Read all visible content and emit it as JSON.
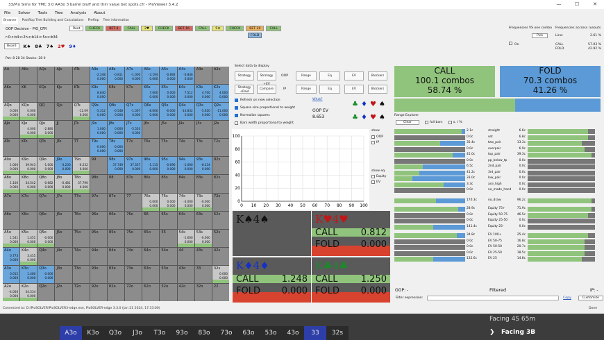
{
  "window": {
    "title": "33/Pio Sims for TMC 3:0 AA3o 3 barrel bluff and thin value bet spots.cfr - PioViewer 3.4.2",
    "min": "—",
    "max": "☐",
    "close": "✕"
  },
  "menu": [
    "File",
    "Solver",
    "Tools",
    "Tree",
    "Analysis",
    "About"
  ],
  "tabs": [
    "Browser",
    "Postflop Tree Building and Calculations",
    "Preflop",
    "Tree information"
  ],
  "decision": "OOP Decision - PIO_CFR",
  "board_line": "r:0:c:b4:c:2h:c:b14:c:5s:c:b34",
  "start_label": "Board",
  "board_cards": [
    {
      "t": "K♠",
      "c": "#111"
    },
    {
      "t": "8♣",
      "c": "#111"
    },
    {
      "t": "7♠",
      "c": "#111"
    },
    {
      "t": "2♥",
      "c": "#c01818"
    },
    {
      "t": "9♦",
      "c": "#1530c8"
    }
  ],
  "pot": "Pot: 8  28 34  Stacks: 28 0",
  "nav": [
    {
      "t": "Root",
      "bg": "#ffffff"
    },
    {
      "t": "CHECK",
      "bg": "#90c47c"
    },
    {
      "t": "BET 4",
      "bg": "#d36b62"
    },
    {
      "t": "CALL",
      "bg": "#90c47c"
    },
    {
      "t": "2♥",
      "bg": "#e6e37a"
    },
    {
      "t": "CHECK",
      "bg": "#90c47c"
    },
    {
      "t": "BET 16",
      "bg": "#d36b62"
    },
    {
      "t": "CALL",
      "bg": "#90c47c"
    },
    {
      "t": "9♦",
      "bg": "#e6e37a"
    },
    {
      "t": "CHECK",
      "bg": "#90c47c"
    },
    {
      "t": "BET 20",
      "bg": "#e8b060"
    },
    {
      "t": "CALL",
      "bg": "#90c47c"
    }
  ],
  "fold_tag": "FOLD",
  "grid": [
    [
      "AA",
      "AKs",
      "AQs",
      "AJs",
      "ATs",
      "A9s",
      "A8s",
      "A7s",
      "A6s",
      "A5s",
      "A4s",
      "A3s",
      "A2s"
    ],
    [
      "AKo",
      "KK",
      "KQs",
      "KJs",
      "KTs",
      "K9s",
      "K8s",
      "K7s",
      "K6s",
      "K5s",
      "K4s",
      "K3s",
      "K2s"
    ],
    [
      "AQo",
      "KQo",
      "QQ",
      "QJs",
      "QTs",
      "Q9s",
      "Q8s",
      "Q7s",
      "Q6s",
      "Q5s",
      "Q4s",
      "Q3s",
      "Q2s"
    ],
    [
      "AJo",
      "KJo",
      "QJo",
      "JJ",
      "JTs",
      "J9s",
      "J8s",
      "J7s",
      "J6s",
      "J5s",
      "J4s",
      "J3s",
      "J2s"
    ],
    [
      "ATo",
      "KTo",
      "QTo",
      "JTo",
      "TT",
      "T9s",
      "T8s",
      "T7s",
      "T6s",
      "T5s",
      "T4s",
      "T3s",
      "T2s"
    ],
    [
      "A9o",
      "K9o",
      "Q9o",
      "J9o",
      "T9o",
      "99",
      "98s",
      "97s",
      "96s",
      "95s",
      "94s",
      "93s",
      "92s"
    ],
    [
      "A8o",
      "K8o",
      "Q8o",
      "J8o",
      "T8o",
      "98o",
      "88",
      "87s",
      "86s",
      "85s",
      "84s",
      "83s",
      "82s"
    ],
    [
      "A7o",
      "K7o",
      "Q7o",
      "J7o",
      "T7o",
      "97o",
      "87o",
      "77",
      "76s",
      "75s",
      "74s",
      "73s",
      "72s"
    ],
    [
      "A6o",
      "K6o",
      "Q6o",
      "J6o",
      "T6o",
      "96o",
      "86o",
      "76o",
      "66",
      "65s",
      "64s",
      "63s",
      "62s"
    ],
    [
      "A5o",
      "K5o",
      "Q5o",
      "J5o",
      "T5o",
      "95o",
      "85o",
      "75o",
      "65o",
      "55",
      "54s",
      "53s",
      "52s"
    ],
    [
      "A4o",
      "K4o",
      "Q4o",
      "J4o",
      "T4o",
      "94o",
      "84o",
      "74o",
      "64o",
      "54o",
      "44",
      "43s",
      "42s"
    ],
    [
      "A3o",
      "K3o",
      "Q3o",
      "J3o",
      "T3o",
      "93o",
      "83o",
      "73o",
      "63o",
      "53o",
      "43o",
      "33",
      "32s"
    ],
    [
      "A2o",
      "K2o",
      "Q2o",
      "J2o",
      "T2o",
      "92o",
      "82o",
      "72o",
      "62o",
      "52o",
      "42o",
      "32o",
      "22"
    ]
  ],
  "cell_values": {
    "A9s": [
      "-2.348",
      "0.000"
    ],
    "A8s": [
      "-0.811",
      "0.000"
    ],
    "A7s": [
      "-1.000",
      "0.000"
    ],
    "A6s": [
      "-3.194",
      "0.000"
    ],
    "A5s": [
      "-0.892",
      "0.000"
    ],
    "A4s": [
      "-0.846",
      "0.000"
    ],
    "K9s": [
      "8.840",
      "0.000"
    ],
    "K6s": [
      "7.600",
      "0.000"
    ],
    "K5s": [
      "0.000",
      "0.000"
    ],
    "K4s": [
      "7.512",
      "0.000"
    ],
    "K3s": [
      "4.700",
      "0.000"
    ],
    "K2s": [
      "4.000",
      "0.000"
    ],
    "Q9s": [
      "-5.312",
      "0.000"
    ],
    "Q8s": [
      "-0.548",
      "0.000"
    ],
    "Q7s": [
      "-1.007",
      "0.000"
    ],
    "Q6s": [
      "-8.000",
      "0.000"
    ],
    "Q5s": [
      "-6.000",
      "0.000"
    ],
    "Q4s": [
      "-14.832",
      "0.000"
    ],
    "Q3s": [
      "-5.620",
      "0.000"
    ],
    "Q2s": [
      "-11.000",
      "0.000"
    ],
    "QTs": [
      "-12.09",
      "0.000"
    ],
    "KQo": [
      "0.000",
      "0.000"
    ],
    "AQo": [
      "0.000",
      "0.000"
    ],
    "KJo": [
      "4.000",
      "0.000"
    ],
    "QJo": [
      "-2.880",
      "0.000"
    ],
    "J9s": [
      "1.000",
      "0.000"
    ],
    "J8s": [
      "0.000",
      "0.000"
    ],
    "J7s": [
      "-5.520",
      "0.000"
    ],
    "T9s": [
      "-0.000",
      "0.000"
    ],
    "T8s": [
      "-0.000",
      "0.000"
    ],
    "A9o": [
      "1.000",
      "0.000"
    ],
    "K9o": [
      "39.943",
      "0.000"
    ],
    "Q9o": [
      "-1.000",
      "0.000"
    ],
    "J9o": [
      "-3.230",
      "0.000"
    ],
    "T9o": [
      "-6.232",
      "0.000"
    ],
    "98s": [
      "37.749",
      "0.000"
    ],
    "97s": [
      "37.537",
      "0.000"
    ],
    "96s": [
      "-1.115",
      "0.000"
    ],
    "95s": [
      "-0.690",
      "0.000"
    ],
    "94s": [
      "-1.000",
      "0.000"
    ],
    "93s": [
      "-8.234",
      "0.000"
    ],
    "A8o": [
      "1.100",
      "0.000"
    ],
    "K8o": [
      "34.542",
      "0.000"
    ],
    "Q8o": [
      "-0.682",
      "0.000"
    ],
    "J8o": [
      "-0.481",
      "0.000"
    ],
    "T8o": [
      "37.790",
      "0.000"
    ],
    "76s": [
      "0.000",
      "0.000"
    ],
    "75s": [
      "0.000",
      "0.000"
    ],
    "74s": [
      "-3.000",
      "0.000"
    ],
    "73s": [
      "-0.000",
      "0.000"
    ],
    "A5o": [
      "1.541",
      "0.000"
    ],
    "K5o": [
      "1.451",
      "0.000"
    ],
    "Q5o": [
      "-0.000",
      "0.000"
    ],
    "54s": [
      "-1.600",
      "0.000"
    ],
    "53s": [
      "-0.000",
      "0.000"
    ],
    "A4o": [
      "0.773",
      "0.000"
    ],
    "K4o": [
      "3.455",
      "0.000"
    ],
    "A3o": [
      "0.012",
      "0.000"
    ],
    "K3o": [
      "1.480",
      "0.000"
    ],
    "Q3o": [
      "-0.000",
      "0.000"
    ],
    "A2o": [
      "-4.000",
      "0.000"
    ],
    "K2o": [
      "34.534",
      "0.000"
    ],
    "32s": [
      "0.000",
      "0.000"
    ]
  },
  "blue_cells": [
    "A9s",
    "A8s",
    "A7s",
    "A6s",
    "A5s",
    "A4s",
    "A3s",
    "A2s",
    "K9s",
    "K6s",
    "K5s",
    "K4s",
    "K3s",
    "K2s",
    "Q9s",
    "Q8s",
    "Q7s",
    "Q6s",
    "Q5s",
    "Q4s",
    "Q3s",
    "Q2s",
    "J9s",
    "J8s",
    "J7s",
    "T9s",
    "T8s",
    "98s",
    "97s",
    "96s",
    "95s",
    "94s",
    "93s",
    "A3o",
    "K3o",
    "Q3o",
    "J9o",
    "A4o"
  ],
  "middle": {
    "select_header": "Select data to display",
    "oop_label": "OOP",
    "ip_label": "IP",
    "row1": [
      "Strategy",
      "Strategy +EV",
      "Range",
      "Eq",
      "EV",
      "Blockers"
    ],
    "row2": [
      "Strategy +Raid",
      "Compare",
      "Range",
      "Eq",
      "EV",
      "Blockers"
    ],
    "checks": [
      {
        "t": "Refresh on new selection",
        "on": true
      },
      {
        "t": "Square size proportional to weight",
        "on": true
      },
      {
        "t": "Normalize squares",
        "on": true
      },
      {
        "t": "Bars width proportional to weight",
        "on": false
      }
    ],
    "what": "What?",
    "oop_ev_label": "OOP EV",
    "oop_ev": "8.653",
    "suits": [
      {
        "s": "♣",
        "c": "#1a8a2a"
      },
      {
        "s": "♦",
        "c": "#1530c8"
      },
      {
        "s": "♥",
        "c": "#c01818"
      },
      {
        "s": "♠",
        "c": "#111"
      }
    ],
    "show": [
      "show",
      "OOP",
      "IP"
    ],
    "show_eq": [
      "show eq",
      "Equity",
      "EV"
    ]
  },
  "chart_data": {
    "type": "line",
    "x_ticks": [
      "0",
      "10",
      "20",
      "30",
      "40",
      "50",
      "60",
      "70",
      "80",
      "90",
      "100"
    ],
    "y_ticks": [
      "0",
      "20",
      "40",
      "60",
      "80",
      "100"
    ],
    "xlim": [
      0,
      100
    ],
    "ylim": [
      0,
      100
    ],
    "grid": true,
    "series": []
  },
  "cards": [
    {
      "name": "K♠4♠",
      "c": "#111",
      "call": "",
      "fold": "",
      "bg": "#5a5a5a",
      "empty": true
    },
    {
      "name": "K♥4♥",
      "c": "#c01818",
      "call": "0.812",
      "fold": "0.000"
    },
    {
      "name": "K♦4♦",
      "c": "#1530c8",
      "call": "1.248",
      "fold": "0.000"
    },
    {
      "name": "K♣4♣",
      "c": "#1a8a2a",
      "call": "1.250",
      "fold": "0.000"
    }
  ],
  "call_word": "CALL",
  "fold_word": "FOLD",
  "summary": {
    "call_title": "CALL",
    "call_combos": "100.1 combos",
    "call_pct": "58.74 %",
    "fold_title": "FOLD",
    "fold_combos": "70.3 combos",
    "fold_pct": "41.26 %",
    "call_fraction": 0.5874
  },
  "range_explorer": {
    "title": "Range Explorer",
    "clear": "Clear",
    "full_bars": "full bars",
    "x_pct": "x, / %"
  },
  "rows": [
    {
      "lv": "2.1c",
      "nm": "straight",
      "rv": "6.6c",
      "g": 0.95,
      "b": 0.05,
      "rg": 0.9
    },
    {
      "lv": "0.0c",
      "nm": "set",
      "rv": "6.8c",
      "g": 0.0,
      "b": 0.0,
      "rg": 0.9
    },
    {
      "lv": "35.4c",
      "nm": "two_pair",
      "rv": "13.3c",
      "g": 0.65,
      "b": 0.35,
      "rg": 0.8
    },
    {
      "lv": "0.0c",
      "nm": "overpair",
      "rv": "6.9c",
      "g": 0.0,
      "b": 0.0,
      "rg": 0.85
    },
    {
      "lv": "45.0c",
      "nm": "top_pair",
      "rv": "39.3c",
      "g": 0.82,
      "b": 0.18,
      "rg": 0.95
    },
    {
      "lv": "0.0c",
      "nm": "pp_below_tp",
      "rv": "0.0c",
      "g": 0.0,
      "b": 0.0,
      "rg": 0.0
    },
    {
      "lv": "6.5c",
      "nm": "2nd_pair",
      "rv": "0.0c",
      "g": 0.4,
      "b": 0.6,
      "rg": 0.0
    },
    {
      "lv": "41.2c",
      "nm": "3rd_pair",
      "rv": "0.0c",
      "g": 0.35,
      "b": 0.65,
      "rg": 0.0
    },
    {
      "lv": "33.0c",
      "nm": "low_pair",
      "rv": "0.0c",
      "g": 0.25,
      "b": 0.75,
      "rg": 0.0
    },
    {
      "lv": "3.3c",
      "nm": "ace_high",
      "rv": "0.0c",
      "g": 0.7,
      "b": 0.3,
      "rg": 0.0
    },
    {
      "lv": "0.0c",
      "nm": "no_made_hand",
      "rv": "0.0c",
      "g": 0.0,
      "b": 0.0,
      "rg": 0.0
    },
    {
      "lv": "170.3c",
      "nm": "no_draw",
      "rv": "96.2c",
      "g": 0.59,
      "b": 0.41,
      "rg": 0.95
    },
    {
      "lv": "28.9c",
      "nm": "Equity 75+",
      "rv": "71.9c",
      "g": 0.9,
      "b": 0.1,
      "rg": 0.95
    },
    {
      "lv": "0.0c",
      "nm": "Equity 50-75",
      "rv": "46.5c",
      "g": 0.0,
      "b": 0.0,
      "rg": 0.9
    },
    {
      "lv": "0.0c",
      "nm": "Equity 25-50",
      "rv": "0.0c",
      "g": 0.0,
      "b": 0.0,
      "rg": 0.0
    },
    {
      "lv": "141.4c",
      "nm": "Equity 25-",
      "rv": "0.0c",
      "g": 0.55,
      "b": 0.45,
      "rg": 0.0
    },
    {
      "lv": "34.8c",
      "nm": "EV 100+",
      "rv": "25.4c",
      "g": 0.88,
      "b": 0.12,
      "rg": 0.9
    },
    {
      "lv": "0.0c",
      "nm": "EV 50-75",
      "rv": "16.8c",
      "g": 0.0,
      "b": 0.0,
      "rg": 0.85
    },
    {
      "lv": "0.0c",
      "nm": "EV 50-50",
      "rv": "20.7c",
      "g": 0.0,
      "b": 0.0,
      "rg": 0.85
    },
    {
      "lv": "0.0c",
      "nm": "EV 25-50",
      "rv": "18.5c",
      "g": 0.0,
      "b": 0.0,
      "rg": 0.85
    },
    {
      "lv": "132.6c",
      "nm": "EV 25",
      "rv": "14.8c",
      "g": 0.55,
      "b": 0.45,
      "rg": 0.8
    }
  ],
  "filtered": "Filtered",
  "oop_colon": "OOP: -",
  "ip_colon": "IP: -",
  "filter_label": "Filter expression:",
  "copy": "Copy",
  "customize": "Customize",
  "top_right": {
    "label1": "Frequencies VS one combo",
    "pick": "Pick",
    "off": "On",
    "label2": "Frequencies accross runouts",
    "line": "Line:",
    "line_val": "2.61 %",
    "call": "CALL",
    "call_val": "57.03 %",
    "fold": "FOLD",
    "fold_val": "42.92 %"
  },
  "status": "Connected to: D:\\PioSOLVER\\PioSOLVER3-edge.exe, PioSOLVER-edge 3.3.0 (Jan 21 2024, 17:33:00)",
  "done": "Done",
  "bottom_tabs": [
    "A3o",
    "K3o",
    "Q3o",
    "J3o",
    "T3o",
    "93o",
    "83o",
    "73o",
    "63o",
    "53o",
    "43o",
    "33",
    "32s"
  ],
  "bottom_highlight": [
    0,
    11
  ],
  "facing_partial": "Facing 4S 65m",
  "facing": "Facing 3B"
}
